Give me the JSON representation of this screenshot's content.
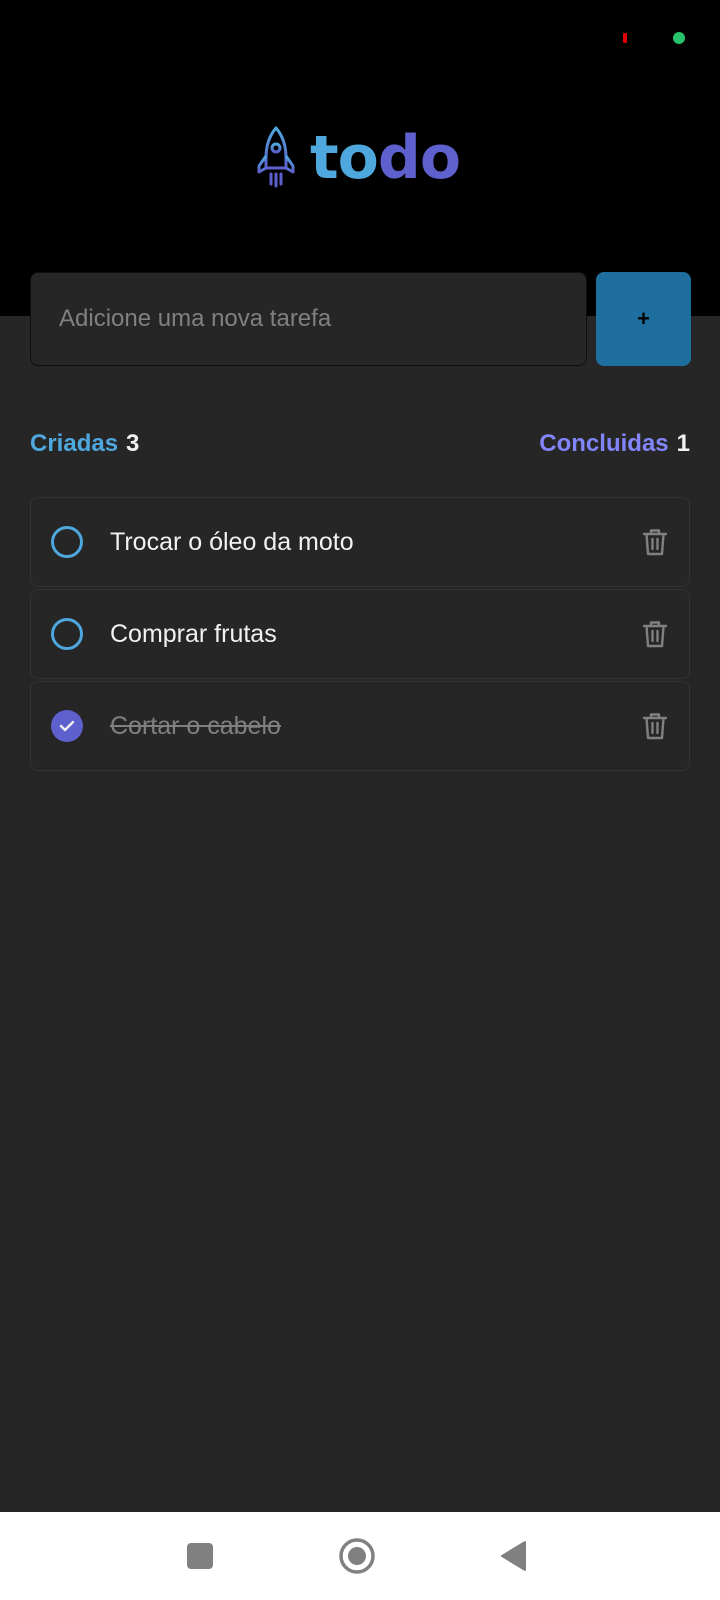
{
  "app": {
    "logo_text_left": "to",
    "logo_text_right": "do",
    "logo_icon": "rocket-icon"
  },
  "new_task": {
    "placeholder": "Adicione uma nova tarefa",
    "value": "",
    "add_label": "+"
  },
  "counters": {
    "created_label": "Criadas",
    "created_count": "3",
    "done_label": "Concluidas",
    "done_count": "1"
  },
  "tasks": [
    {
      "text": "Trocar o óleo da moto",
      "done": false
    },
    {
      "text": "Comprar frutas",
      "done": false
    },
    {
      "text": "Cortar o cabelo",
      "done": true
    }
  ],
  "icons": {
    "unchecked": "circle-icon",
    "checked": "check-icon",
    "delete": "trash-icon",
    "nav_recents": "square-icon",
    "nav_home": "home-circle-icon",
    "nav_back": "back-triangle-icon"
  },
  "colors": {
    "header_bg": "#000000",
    "page_bg": "#262626",
    "blue": "#4ea8de",
    "blue_dark": "#1e6f9f",
    "purple": "#5e60ce",
    "purple_light": "#8284fa",
    "status_red": "#e00000",
    "status_green": "#27c26b"
  }
}
